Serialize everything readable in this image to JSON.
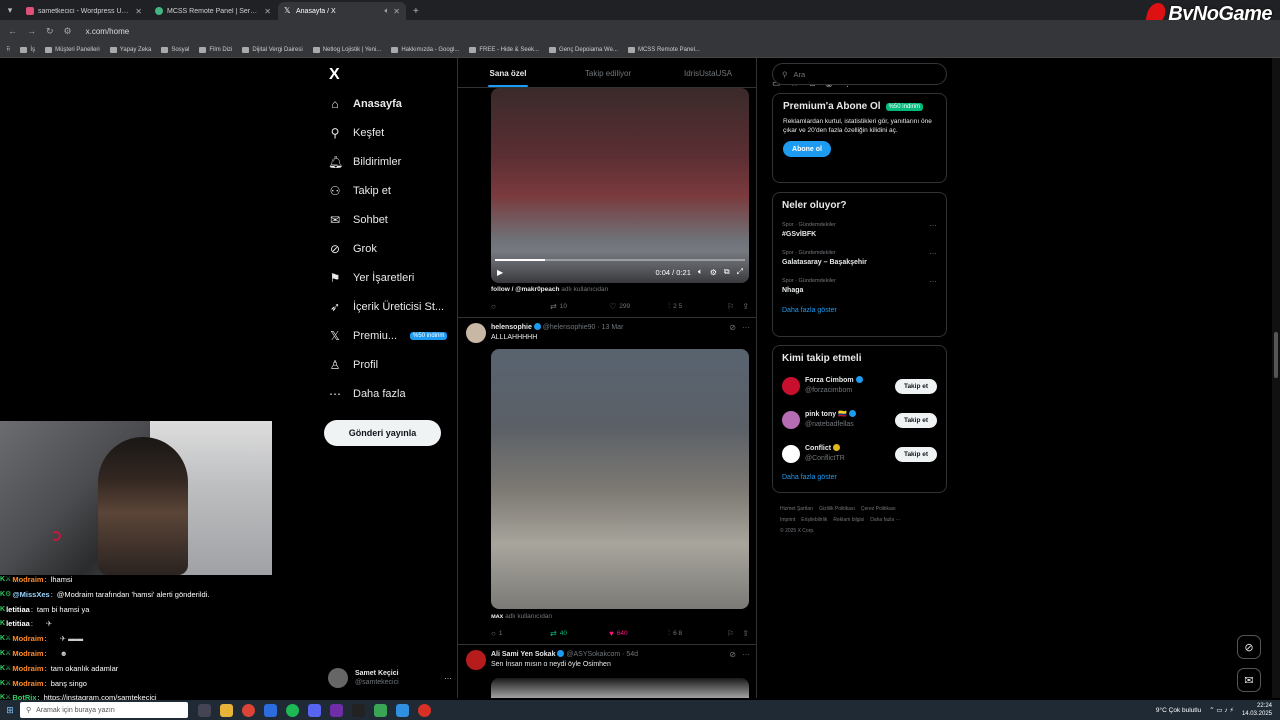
{
  "browser": {
    "tabs": [
      {
        "title": "sametkecici - Wordpress Uzman...",
        "color": "#e04f7a",
        "active": false
      },
      {
        "title": "MCSS Remote Panel | Servers",
        "color": "#43b581",
        "active": false
      },
      {
        "title": "Anasayfa / X",
        "color": "#ffffff",
        "active": true
      }
    ],
    "url": "x.com/home",
    "bookmarks": [
      "İş",
      "Müşteri Panelleri",
      "Yapay Zeka",
      "Sosyal",
      "Film Dizi",
      "Dijital Vergi Dairesi",
      "Netlog Lojistik | Yeni...",
      "Hakkımızda - Googl...",
      "FREE - Hide & Seek...",
      "Genç Depoiama We...",
      "MCSS Remote Panel..."
    ],
    "brand": "ByNoGame"
  },
  "nav": {
    "logo": "X",
    "items": [
      {
        "label": "Anasayfa",
        "icon": "home-icon",
        "glyph": "⌂"
      },
      {
        "label": "Keşfet",
        "icon": "search-icon",
        "glyph": "⚲"
      },
      {
        "label": "Bildirimler",
        "icon": "bell-icon",
        "glyph": "🔔︎"
      },
      {
        "label": "Takip et",
        "icon": "follow-icon",
        "glyph": "⚇"
      },
      {
        "label": "Sohbet",
        "icon": "mail-icon",
        "glyph": "✉"
      },
      {
        "label": "Grok",
        "icon": "grok-icon",
        "glyph": "⊘"
      },
      {
        "label": "Yer İşaretleri",
        "icon": "bookmark-icon",
        "glyph": "⚑"
      },
      {
        "label": "İçerik Üreticisi St...",
        "icon": "rocket-icon",
        "glyph": "➶"
      },
      {
        "label": "Premiu...",
        "icon": "x-premium-icon",
        "glyph": "𝕏",
        "badge": "%50 indirim"
      },
      {
        "label": "Profil",
        "icon": "person-icon",
        "glyph": "♙"
      },
      {
        "label": "Daha fazla",
        "icon": "more-icon",
        "glyph": "⋯"
      }
    ],
    "post_button": "Gönderi yayınla",
    "account": {
      "name": "Samet Keçici",
      "handle": "@samtekecici"
    }
  },
  "feed": {
    "tabs": [
      "Sana özel",
      "Takip ediliyor",
      "IdrisUstaUSA"
    ],
    "video1": {
      "time": "0:04 / 0:21",
      "progress": 0.2
    },
    "post1": {
      "credit_user": "follow / @makr0peach",
      "credit_suffix": "adlı kullanıcıdan",
      "replies": "",
      "reposts": "10",
      "likes": "299",
      "views": "2 5"
    },
    "post2": {
      "name": "helensophie",
      "handle": "@helensophie90 · 13 Mar",
      "text": "ALLLAHHHHH",
      "credit_user": "ᴍᴀx",
      "credit_suffix": "adlı kullanıcıdan",
      "replies": "1",
      "reposts": "40",
      "likes": "640",
      "views": "6 8"
    },
    "post3": {
      "name": "Ali Sami Yen Sokak",
      "handle": "@ASYSokakcom · 54d",
      "text": "Sen İnsan mısın o neydi öyle Osimhen"
    }
  },
  "right": {
    "search_placeholder": "Ara",
    "premium": {
      "title": "Premium'a Abone Ol",
      "badge": "%50 indirim",
      "text": "Reklamlardan kurtul, istatistikleri gör, yanıtlarını öne çıkar ve 20'den fazla özelliğin kilidini aç.",
      "button": "Abone ol"
    },
    "trends": {
      "title": "Neler oluyor?",
      "items": [
        {
          "category": "Spor · Gündemdekiler",
          "name": "#GSvİBFK"
        },
        {
          "category": "Spor · Gündemdekiler",
          "name": "Galatasaray – Başakşehir"
        },
        {
          "category": "Spor · Gündemdekiler",
          "name": "Nhaga"
        }
      ],
      "show_more": "Daha fazla göster"
    },
    "who": {
      "title": "Kimi takip etmeli",
      "items": [
        {
          "name": "Forza Cimbom",
          "handle": "@forzacimbom",
          "color": "#c8102e"
        },
        {
          "name": "pink tony 🇨🇴",
          "handle": "@natebadfellas",
          "color": "#b56cb3"
        },
        {
          "name": "Conflict",
          "handle": "@ConflictTR",
          "color": "#ffffff"
        }
      ],
      "follow_label": "Takip et",
      "show_more": "Daha fazla göster"
    },
    "footer": [
      "Hizmet Şartları",
      "Gizlilik Politikası",
      "Çerez Politikası",
      "Imprint",
      "Erişilebilirlik",
      "Reklam bilgisi",
      "Daha fazla ···",
      "© 2025 X Corp."
    ]
  },
  "chat": [
    {
      "user": "Modraim",
      "msg": "lhamsi",
      "color": "#ff8c2b"
    },
    {
      "user": "@MissXes",
      "msg": "@Modraim tarafından 'hamsi' alerti gönderildi.",
      "color": "#9ad5ff"
    },
    {
      "user": "letitiaa",
      "msg": "tam bi hamsi ya",
      "color": "#ffffff"
    },
    {
      "user": "letitiaa",
      "msg": "",
      "color": "#ffffff"
    },
    {
      "user": "Modraim",
      "msg": "",
      "color": "#ff8c2b"
    },
    {
      "user": "Modraim",
      "msg": "",
      "color": "#ff8c2b"
    },
    {
      "user": "Modraim",
      "msg": "tam okanlık adamlar",
      "color": "#ff8c2b"
    },
    {
      "user": "Modraim",
      "msg": "banş singo",
      "color": "#ff8c2b"
    },
    {
      "user": "BotRix",
      "msg": "https://instagram.com/samtekecici",
      "color": "#2fd062"
    }
  ],
  "taskbar": {
    "search": "Aramak için buraya yazın",
    "weather": "9°C  Çok bulutlu",
    "time": "22:24",
    "date": "14.03.2025"
  }
}
